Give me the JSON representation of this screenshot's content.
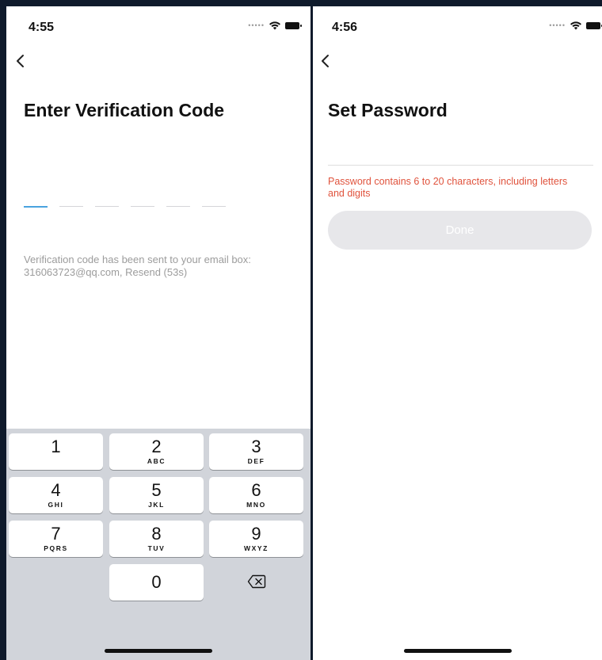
{
  "left_screen": {
    "status_time": "4:55",
    "title": "Enter Verification Code",
    "code_length": 6,
    "sent_note": "Verification code has been sent to your email box: 316063723@qq.com, Resend (53s)",
    "keypad": {
      "keys": [
        {
          "digit": "1",
          "letters": ""
        },
        {
          "digit": "2",
          "letters": "ABC"
        },
        {
          "digit": "3",
          "letters": "DEF"
        },
        {
          "digit": "4",
          "letters": "GHI"
        },
        {
          "digit": "5",
          "letters": "JKL"
        },
        {
          "digit": "6",
          "letters": "MNO"
        },
        {
          "digit": "7",
          "letters": "PQRS"
        },
        {
          "digit": "8",
          "letters": "TUV"
        },
        {
          "digit": "9",
          "letters": "WXYZ"
        },
        {
          "digit": "0",
          "letters": ""
        }
      ]
    }
  },
  "right_screen": {
    "status_time": "4:56",
    "title": "Set Password",
    "password_value": "",
    "password_hint": "Password contains 6 to 20 characters, including letters and digits",
    "done_label": "Done"
  },
  "status_icons": [
    "signal-dots-icon",
    "wifi-icon",
    "battery-icon"
  ],
  "colors": {
    "background": "#0f1a2b",
    "active_underline": "#4aa3df",
    "hint_text": "#e0533d",
    "button_disabled": "#e7e7ea",
    "keypad_bg": "#d1d4da"
  }
}
